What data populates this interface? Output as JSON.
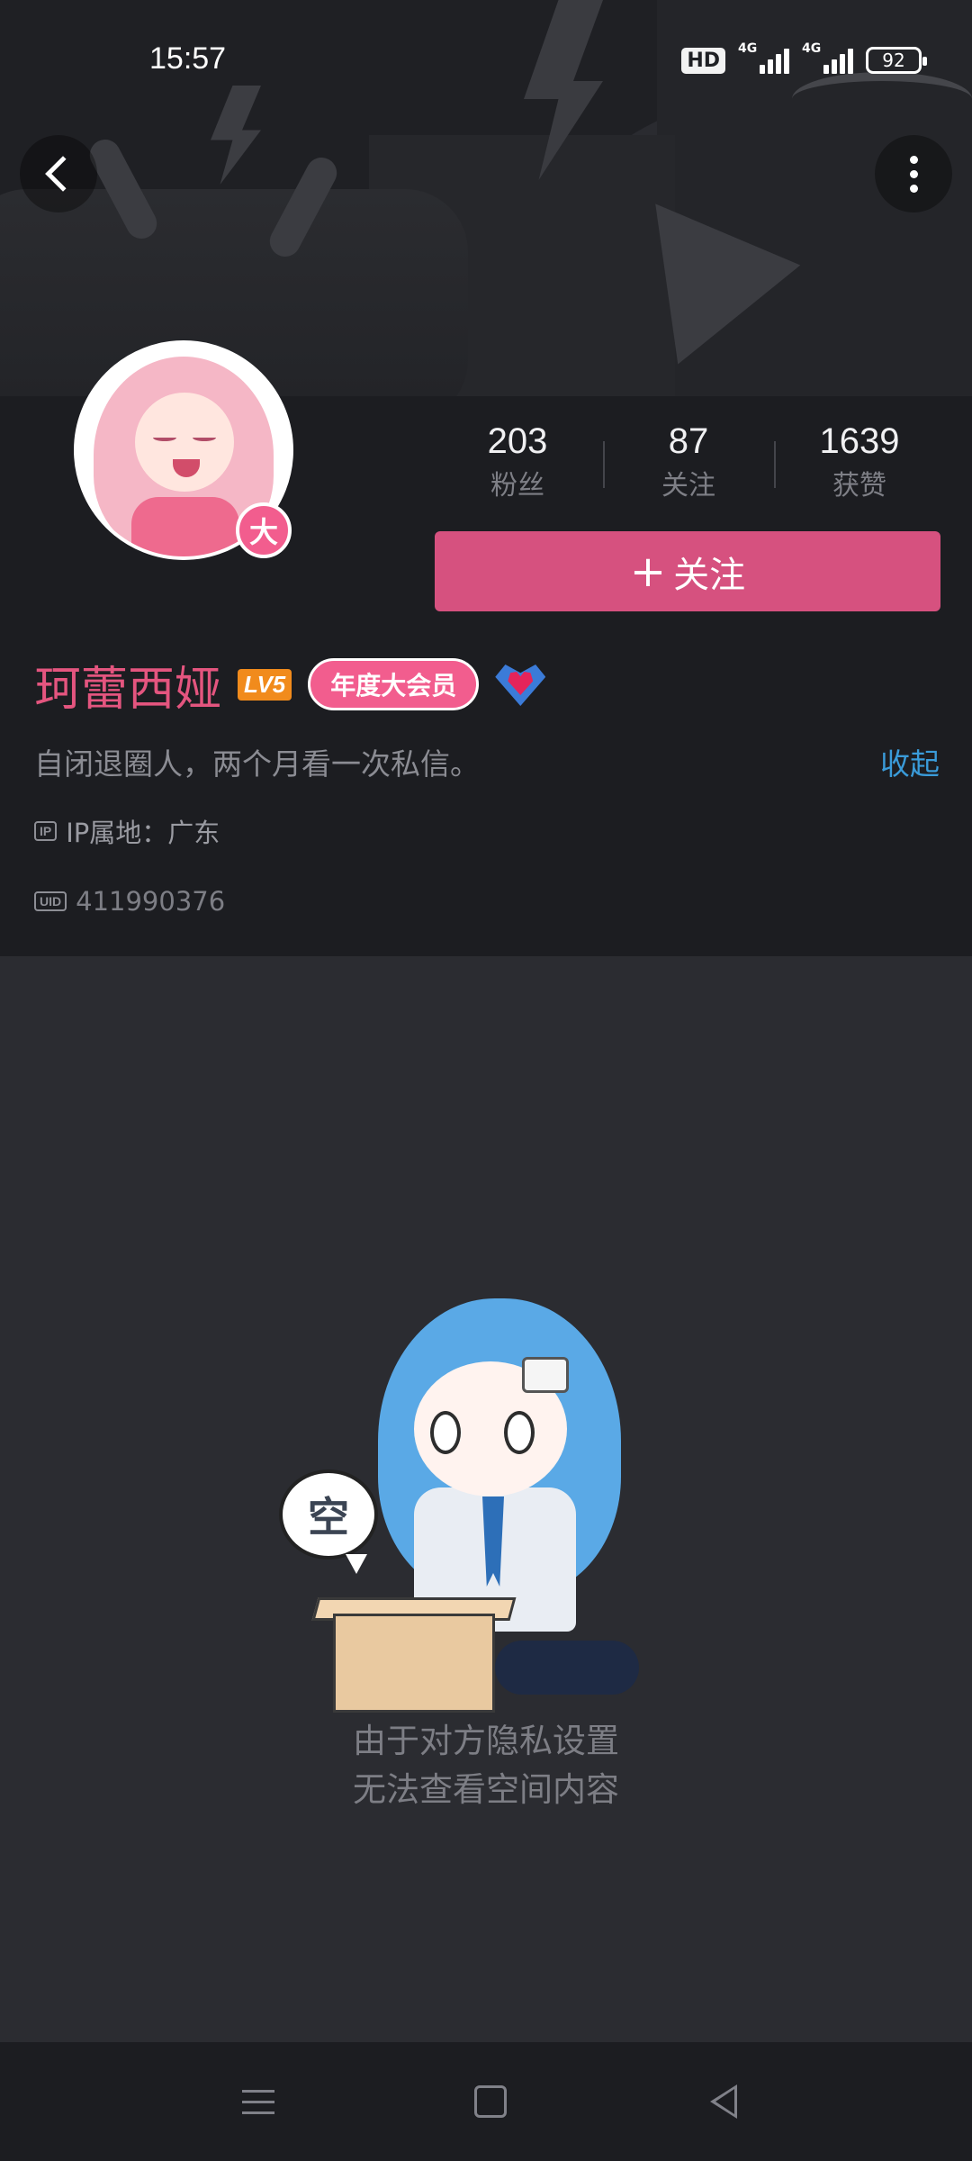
{
  "status_bar": {
    "time": "15:57",
    "hd_label": "HD",
    "network_1": "4G",
    "network_2": "4G",
    "battery": "92"
  },
  "header": {
    "back_icon": "chevron-left-icon",
    "more_icon": "more-vertical-icon"
  },
  "profile": {
    "vip_badge": "大",
    "stats": [
      {
        "value": "203",
        "label": "粉丝"
      },
      {
        "value": "87",
        "label": "关注"
      },
      {
        "value": "1639",
        "label": "获赞"
      }
    ],
    "follow_button": {
      "plus": "+",
      "label": "关注"
    },
    "name": "珂蕾西娅",
    "level": "LV5",
    "membership": "年度大会员",
    "bio": "自闭退圈人，两个月看一次私信。",
    "collapse_label": "收起",
    "ip_tag": "IP",
    "ip_location": "IP属地：广东",
    "uid_tag": "UID",
    "uid": "411990376"
  },
  "empty_state": {
    "bubble_text": "空",
    "line1": "由于对方隐私设置",
    "line2": "无法查看空间内容"
  },
  "colors": {
    "accent_pink": "#d6517f",
    "name_pink": "#e4557f",
    "link_blue": "#3a9bd9",
    "level_orange": "#f18b1c"
  }
}
